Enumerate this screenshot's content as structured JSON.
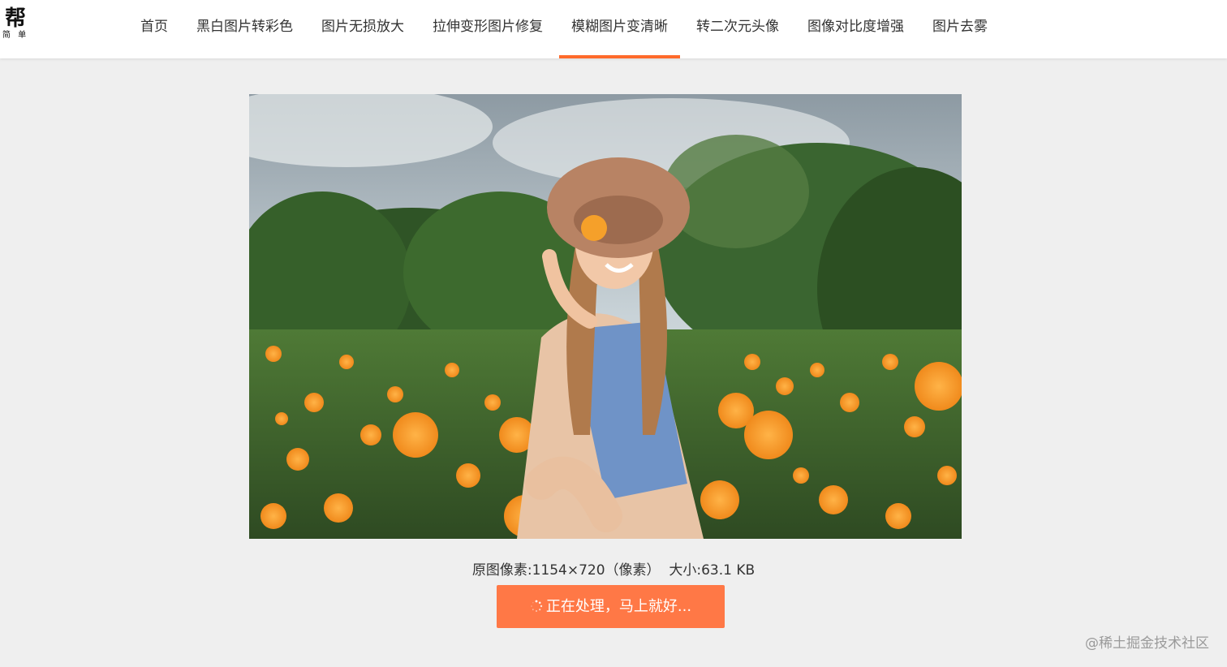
{
  "logo": {
    "main": "帮",
    "sub": "简 单"
  },
  "nav": {
    "items": [
      {
        "label": "首页"
      },
      {
        "label": "黑白图片转彩色"
      },
      {
        "label": "图片无损放大"
      },
      {
        "label": "拉伸变形图片修复"
      },
      {
        "label": "模糊图片变清晰",
        "active": true
      },
      {
        "label": "转二次元头像"
      },
      {
        "label": "图像对比度增强"
      },
      {
        "label": "图片去雾"
      }
    ],
    "active_color": "#ff6a2b"
  },
  "image_info": {
    "pixels": "原图像素:1154×720（像素）",
    "size": "大小:63.1 KB"
  },
  "process_button": {
    "label": "正在处理，马上就好...",
    "color": "#ff7846",
    "icon": "spinner-icon"
  },
  "watermark": "@稀土掘金技术社区"
}
